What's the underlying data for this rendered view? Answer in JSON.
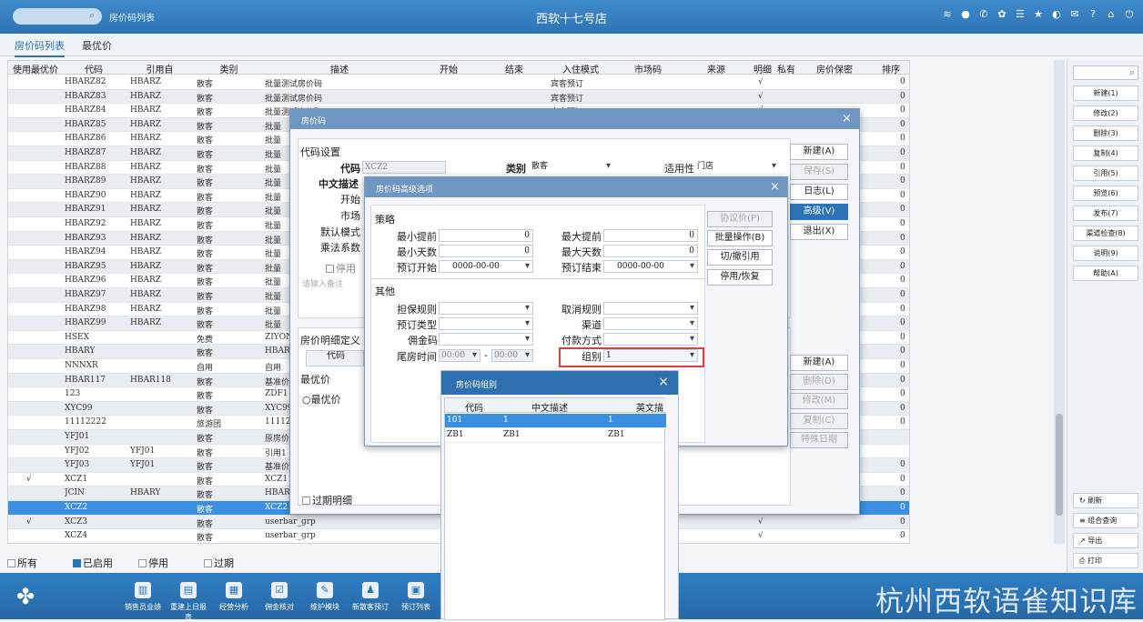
{
  "header": {
    "search_icon": "search-icon",
    "breadcrumb": "房价码列表",
    "store": "西软十七号店",
    "icons": [
      "wifi-icon",
      "chat-icon",
      "phone-icon",
      "palette-icon",
      "list-icon",
      "star-icon",
      "moon-icon",
      "mail-icon",
      "help-icon",
      "home-icon",
      "power-icon"
    ]
  },
  "tabs": [
    "房价码列表",
    "最优价"
  ],
  "grid": {
    "columns": [
      "使用最优价",
      "代码",
      "引用自",
      "类别",
      "描述",
      "开始",
      "结束",
      "入住模式",
      "市场码",
      "来源",
      "明细",
      "私有",
      "房价保密",
      "排序"
    ],
    "rows": [
      {
        "best": "",
        "code": "HBARZ82",
        "ref": "HBARZ",
        "cat": "散客",
        "desc": "批量测试房价码",
        "mode": "宾客预订",
        "detail": "√",
        "sort": "0"
      },
      {
        "best": "",
        "code": "HBARZ83",
        "ref": "HBARZ",
        "cat": "散客",
        "desc": "批量测试房价码",
        "mode": "宾客预订",
        "detail": "√",
        "sort": "0"
      },
      {
        "best": "",
        "code": "HBARZ84",
        "ref": "HBARZ",
        "cat": "散客",
        "desc": "批量测试房价码",
        "mode": "宾客预订",
        "detail": "√",
        "sort": "0"
      },
      {
        "best": "",
        "code": "HBARZ85",
        "ref": "HBARZ",
        "cat": "散客",
        "desc": "批量",
        "mode": "",
        "detail": "",
        "sort": "0"
      },
      {
        "best": "",
        "code": "HBARZ86",
        "ref": "HBARZ",
        "cat": "散客",
        "desc": "批量",
        "mode": "",
        "detail": "",
        "sort": "0"
      },
      {
        "best": "",
        "code": "HBARZ87",
        "ref": "HBARZ",
        "cat": "散客",
        "desc": "批量",
        "mode": "",
        "detail": "",
        "sort": "0"
      },
      {
        "best": "",
        "code": "HBARZ88",
        "ref": "HBARZ",
        "cat": "散客",
        "desc": "批量",
        "mode": "",
        "detail": "",
        "sort": "0"
      },
      {
        "best": "",
        "code": "HBARZ89",
        "ref": "HBARZ",
        "cat": "散客",
        "desc": "批量",
        "mode": "",
        "detail": "",
        "sort": "0"
      },
      {
        "best": "",
        "code": "HBARZ90",
        "ref": "HBARZ",
        "cat": "散客",
        "desc": "批量",
        "mode": "",
        "detail": "",
        "sort": "0"
      },
      {
        "best": "",
        "code": "HBARZ91",
        "ref": "HBARZ",
        "cat": "散客",
        "desc": "批量",
        "mode": "",
        "detail": "",
        "sort": "0"
      },
      {
        "best": "",
        "code": "HBARZ92",
        "ref": "HBARZ",
        "cat": "散客",
        "desc": "批量",
        "mode": "",
        "detail": "",
        "sort": "0"
      },
      {
        "best": "",
        "code": "HBARZ93",
        "ref": "HBARZ",
        "cat": "散客",
        "desc": "批量",
        "mode": "",
        "detail": "",
        "sort": "0"
      },
      {
        "best": "",
        "code": "HBARZ94",
        "ref": "HBARZ",
        "cat": "散客",
        "desc": "批量",
        "mode": "",
        "detail": "",
        "sort": "0"
      },
      {
        "best": "",
        "code": "HBARZ95",
        "ref": "HBARZ",
        "cat": "散客",
        "desc": "批量",
        "mode": "",
        "detail": "",
        "sort": "0"
      },
      {
        "best": "",
        "code": "HBARZ96",
        "ref": "HBARZ",
        "cat": "散客",
        "desc": "批量",
        "mode": "",
        "detail": "",
        "sort": "0"
      },
      {
        "best": "",
        "code": "HBARZ97",
        "ref": "HBARZ",
        "cat": "散客",
        "desc": "批量",
        "mode": "",
        "detail": "",
        "sort": "0"
      },
      {
        "best": "",
        "code": "HBARZ98",
        "ref": "HBARZ",
        "cat": "散客",
        "desc": "批量",
        "mode": "",
        "detail": "",
        "sort": "0"
      },
      {
        "best": "",
        "code": "HBARZ99",
        "ref": "HBARZ",
        "cat": "散客",
        "desc": "批量",
        "mode": "",
        "detail": "",
        "sort": "0"
      },
      {
        "best": "",
        "code": "HSEX",
        "ref": "",
        "cat": "免费",
        "desc": "ZIYON",
        "mode": "",
        "detail": "",
        "sort": "0"
      },
      {
        "best": "",
        "code": "HBARY",
        "ref": "",
        "cat": "散客",
        "desc": "HBARY",
        "mode": "",
        "detail": "",
        "sort": "0"
      },
      {
        "best": "",
        "code": "NNNXR",
        "ref": "",
        "cat": "自用",
        "desc": "自用",
        "mode": "",
        "detail": "",
        "sort": "0"
      },
      {
        "best": "",
        "code": "HBAR117",
        "ref": "HBAR118",
        "cat": "散客",
        "desc": "基准价",
        "mode": "",
        "detail": "",
        "sort": "0"
      },
      {
        "best": "",
        "code": "123",
        "ref": "",
        "cat": "散客",
        "desc": "ZDF1",
        "mode": "",
        "detail": "",
        "sort": "0"
      },
      {
        "best": "",
        "code": "XYC99",
        "ref": "",
        "cat": "散客",
        "desc": "XYC99",
        "mode": "",
        "detail": "",
        "sort": "0"
      },
      {
        "best": "",
        "code": "11112222",
        "ref": "",
        "cat": "旅游团",
        "desc": "11112",
        "mode": "",
        "detail": "",
        "sort": "0"
      },
      {
        "best": "",
        "code": "YFJ01",
        "ref": "",
        "cat": "散客",
        "desc": "原房价",
        "mode": "",
        "detail": "",
        "sort": ""
      },
      {
        "best": "",
        "code": "YFJ02",
        "ref": "YFJ01",
        "cat": "散客",
        "desc": "引用1",
        "mode": "",
        "detail": "",
        "sort": ""
      },
      {
        "best": "",
        "code": "YFJ03",
        "ref": "YFJ01",
        "cat": "散客",
        "desc": "基准价",
        "mode": "",
        "detail": "",
        "sort": "0"
      },
      {
        "best": "√",
        "code": "XCZ1",
        "ref": "",
        "cat": "散客",
        "desc": "XCZ1",
        "mode": "",
        "detail": "",
        "sort": "0"
      },
      {
        "best": "",
        "code": "JCIN",
        "ref": "HBARY",
        "cat": "散客",
        "desc": "HBARY",
        "mode": "",
        "detail": "",
        "sort": "0"
      },
      {
        "best": "",
        "code": "XCZ2",
        "ref": "",
        "cat": "散客",
        "desc": "XCZ2",
        "mode": "",
        "detail": "",
        "sort": "0",
        "selected": true
      },
      {
        "best": "√",
        "code": "XCZ3",
        "ref": "",
        "cat": "散客",
        "desc": "userbar_grp",
        "mode": "",
        "detail": "√",
        "sort": "0"
      },
      {
        "best": "",
        "code": "XCZ4",
        "ref": "",
        "cat": "散客",
        "desc": "userbar_grp",
        "mode": "",
        "detail": "√",
        "sort": "0"
      }
    ]
  },
  "filters": {
    "all": "所有",
    "enabled": "已启用",
    "stopped": "停用",
    "expired": "过期"
  },
  "footer": {
    "app_icon": "grid-app-icon",
    "buttons": [
      "销售员业绩",
      "重建上日报表",
      "经营分析",
      "佣金核对",
      "维护模块",
      "新散客预订",
      "预订列表"
    ],
    "watermark": "杭州西软语雀知识库"
  },
  "right_panel": {
    "search_icon": "search-icon",
    "buttons": [
      "新建(1)",
      "修改(2)",
      "删除(3)",
      "复制(4)",
      "引用(5)",
      "预览(6)",
      "发布(7)",
      "渠道检查(8)",
      "说明(9)",
      "帮助(A)"
    ],
    "bottom_buttons": [
      "↻ 刷新",
      "≡ 组合查询",
      "↗ 导出",
      "⎙ 打印"
    ]
  },
  "dialog_ratecode": {
    "title": "房价码",
    "section_code": "代码设置",
    "code_label": "代码",
    "code_value": "XCZ2",
    "cat_label": "类别",
    "cat_value": "散客",
    "apply_label": "适用性",
    "apply_value": "门店",
    "desc_label": "中文描述",
    "start_label": "开始",
    "market_label": "市场",
    "mode_label": "默认模式",
    "factor_label": "乘法系数",
    "stop_label": "停用",
    "remark_placeholder": "请输入备注",
    "detail_label": "房价明细定义",
    "detail_col": "代码",
    "expired_label": "过期明细",
    "best_label": "最优价",
    "best_opt": "最优价",
    "buttons_top": [
      "新建(A)",
      "保存(S)",
      "日志(L)",
      "高级(V)",
      "退出(X)"
    ],
    "buttons_bottom": [
      "新建(A)",
      "删除(D)",
      "修改(M)",
      "复制(C)",
      "特殊日期"
    ]
  },
  "dialog_advanced": {
    "title": "房价码高级选项",
    "strategy": "策略",
    "min_adv": "最小提前",
    "min_adv_v": "0",
    "max_adv": "最大提前",
    "max_adv_v": "0",
    "min_days": "最小天数",
    "min_days_v": "0",
    "max_days": "最大天数",
    "max_days_v": "0",
    "book_start": "预订开始",
    "book_start_v": "0000-00-00",
    "book_end": "预订结束",
    "book_end_v": "0000-00-00",
    "other": "其他",
    "guarantee": "担保规则",
    "cancel": "取消规则",
    "book_type": "预订类型",
    "channel": "渠道",
    "commission": "佣金码",
    "payment": "付款方式",
    "tail_time": "尾房时间",
    "tail_from": "00:00",
    "tail_sep": "-",
    "tail_to": "00:00",
    "group": "组别",
    "group_v": "1",
    "buttons": [
      "协议价(P)",
      "批量操作(B)",
      "切/撤引用",
      "停用/恢复"
    ]
  },
  "dialog_group": {
    "title": "房价码组别",
    "columns": [
      "代码",
      "中文描述",
      "英文描"
    ],
    "rows": [
      [
        "101",
        "1",
        "1"
      ],
      [
        "ZB1",
        "ZB1",
        "ZB1"
      ]
    ]
  }
}
